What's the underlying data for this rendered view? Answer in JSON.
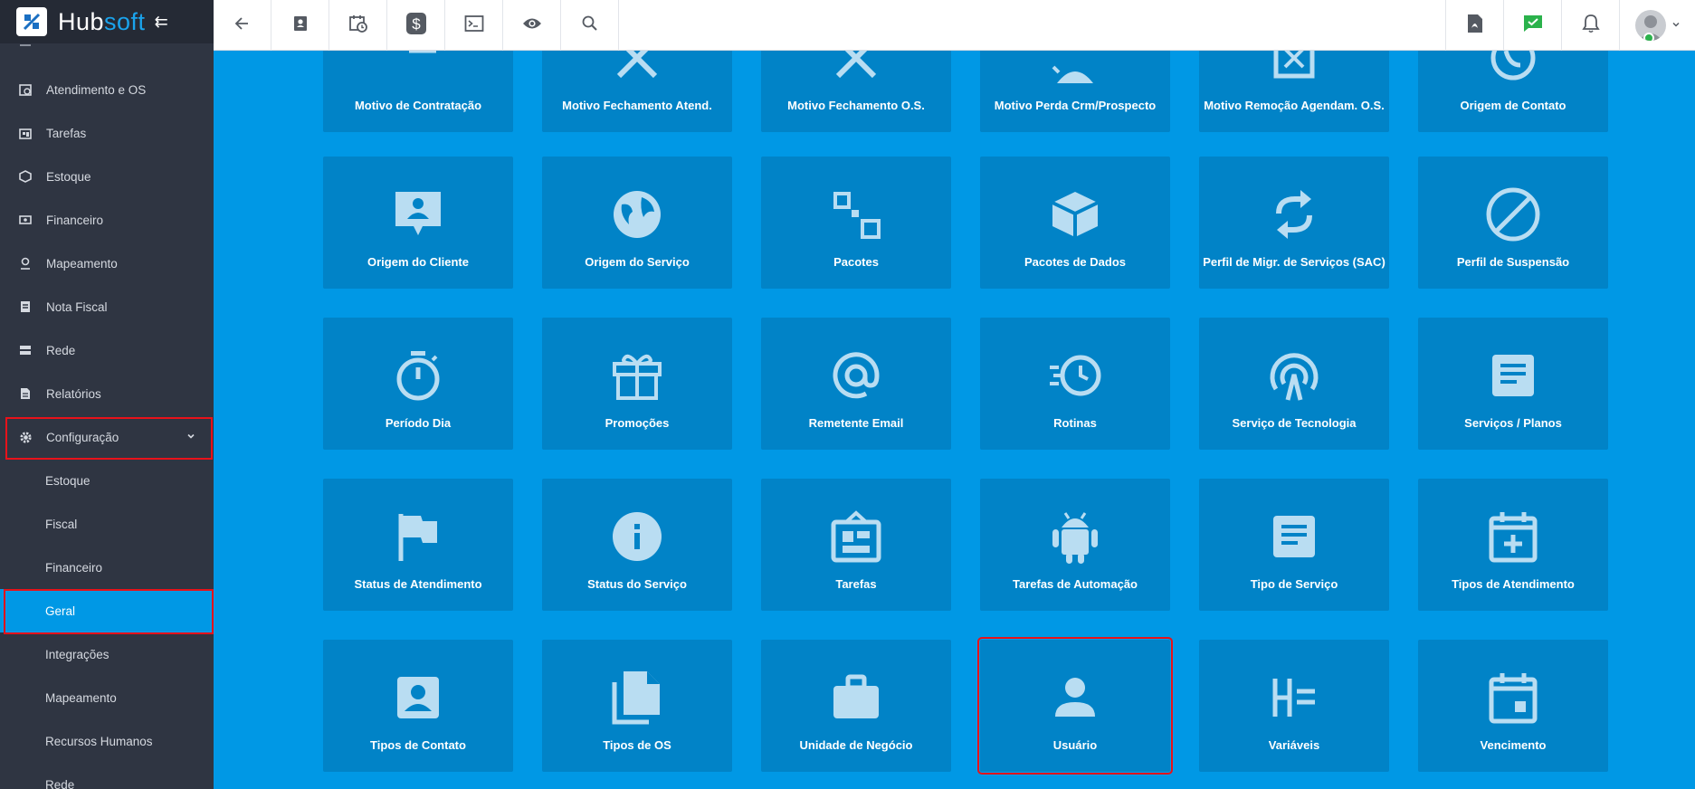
{
  "brand": {
    "name_main": "Hub",
    "name_accent": "soft"
  },
  "sidebar": {
    "items": [
      {
        "label": "Atendimento e OS",
        "icon": "calendar-clock-icon"
      },
      {
        "label": "Tarefas",
        "icon": "tasks-icon"
      },
      {
        "label": "Estoque",
        "icon": "box-icon"
      },
      {
        "label": "Financeiro",
        "icon": "money-icon"
      },
      {
        "label": "Mapeamento",
        "icon": "map-pin-icon"
      },
      {
        "label": "Nota Fiscal",
        "icon": "receipt-icon"
      },
      {
        "label": "Rede",
        "icon": "network-icon"
      },
      {
        "label": "Relatórios",
        "icon": "report-icon"
      },
      {
        "label": "Configuração",
        "icon": "gear-icon"
      }
    ],
    "subitems": [
      {
        "label": "Estoque"
      },
      {
        "label": "Fiscal"
      },
      {
        "label": "Financeiro"
      },
      {
        "label": "Geral"
      },
      {
        "label": "Integrações"
      },
      {
        "label": "Mapeamento"
      },
      {
        "label": "Recursos Humanos"
      },
      {
        "label": "Rede"
      }
    ]
  },
  "topbar": {
    "left_icons": [
      "back-arrow-icon",
      "contact-card-icon",
      "calendar-clock-icon",
      "dollar-icon",
      "terminal-icon",
      "eye-icon",
      "search-icon"
    ],
    "right_icons": [
      "pdf-icon",
      "chat-check-icon",
      "bell-icon"
    ]
  },
  "tiles": [
    {
      "label": "Motivo de Contratação",
      "icon": "list-icon"
    },
    {
      "label": "Motivo Fechamento Atend.",
      "icon": "close-icon"
    },
    {
      "label": "Motivo Fechamento O.S.",
      "icon": "close-icon"
    },
    {
      "label": "Motivo Perda Crm/Prospecto",
      "icon": "person-icon"
    },
    {
      "label": "Motivo Remoção Agendam. O.S.",
      "icon": "box-x-icon"
    },
    {
      "label": "Origem de Contato",
      "icon": "whatsapp-icon"
    },
    {
      "label": "Origem do Cliente",
      "icon": "person-chat-icon"
    },
    {
      "label": "Origem do Serviço",
      "icon": "globe-icon"
    },
    {
      "label": "Pacotes",
      "icon": "squares-icon"
    },
    {
      "label": "Pacotes de Dados",
      "icon": "package-icon"
    },
    {
      "label": "Perfil de Migr. de Serviços (SAC)",
      "icon": "sync-icon"
    },
    {
      "label": "Perfil de Suspensão",
      "icon": "block-icon"
    },
    {
      "label": "Período Dia",
      "icon": "stopwatch-icon"
    },
    {
      "label": "Promoções",
      "icon": "gift-icon"
    },
    {
      "label": "Remetente Email",
      "icon": "at-icon"
    },
    {
      "label": "Rotinas",
      "icon": "fast-clock-icon"
    },
    {
      "label": "Serviço de Tecnologia",
      "icon": "antenna-icon"
    },
    {
      "label": "Serviços / Planos",
      "icon": "document-icon"
    },
    {
      "label": "Status de Atendimento",
      "icon": "flag-icon"
    },
    {
      "label": "Status do Serviço",
      "icon": "info-icon"
    },
    {
      "label": "Tarefas",
      "icon": "dashboard-icon"
    },
    {
      "label": "Tarefas de Automação",
      "icon": "android-icon"
    },
    {
      "label": "Tipo de Serviço",
      "icon": "document-icon"
    },
    {
      "label": "Tipos de Atendimento",
      "icon": "calendar-plus-icon"
    },
    {
      "label": "Tipos de Contato",
      "icon": "contact-card-icon"
    },
    {
      "label": "Tipos de OS",
      "icon": "files-icon"
    },
    {
      "label": "Unidade de Negócio",
      "icon": "briefcase-icon"
    },
    {
      "label": "Usuário",
      "icon": "user-icon"
    },
    {
      "label": "Variáveis",
      "icon": "variables-icon"
    },
    {
      "label": "Vencimento",
      "icon": "calendar-icon"
    }
  ],
  "colors": {
    "accent": "#0098e5",
    "tile": "#0183c7",
    "sidebar": "#2f3542",
    "highlight": "#e8121a",
    "icon": "#b9ddf2"
  }
}
